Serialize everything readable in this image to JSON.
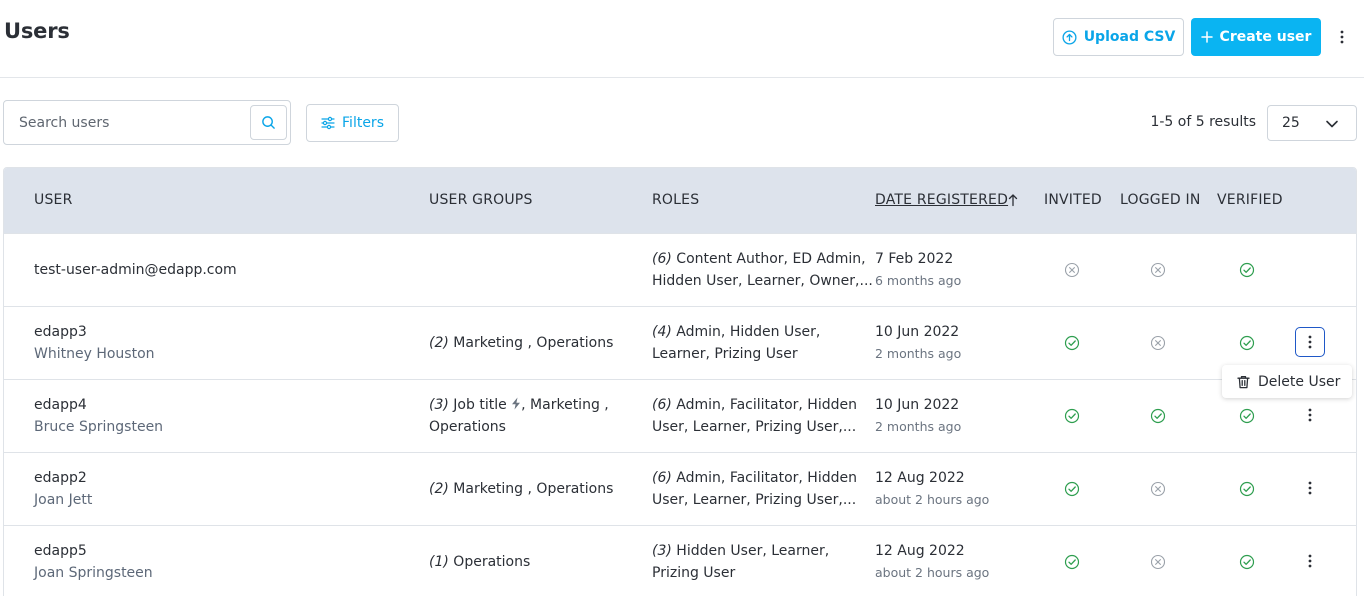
{
  "header": {
    "title": "Users",
    "upload_label": "Upload CSV",
    "create_label": "Create user"
  },
  "toolbar": {
    "search_placeholder": "Search users",
    "filters_label": "Filters",
    "results_text": "1-5 of 5 results",
    "page_size": "25"
  },
  "table": {
    "columns": {
      "user": "USER",
      "user_groups": "USER GROUPS",
      "roles": "ROLES",
      "date_registered": "DATE REGISTERED",
      "invited": "INVITED",
      "logged_in": "LOGGED IN",
      "verified": "VERIFIED"
    },
    "rows": [
      {
        "username": "test-user-admin@edapp.com",
        "name": "",
        "groups_count": "",
        "groups_line1": "",
        "groups_line2": "",
        "roles_count": "(6)",
        "roles_line1": "Content Author, ED Admin,",
        "roles_line2": "Hidden User, Learner, Owner,...",
        "date": "7 Feb 2022",
        "ago": "6 months ago",
        "invited": false,
        "logged_in": false,
        "verified": true
      },
      {
        "username": "edapp3",
        "name": "Whitney Houston",
        "groups_count": "(2)",
        "groups_line1": "Marketing , Operations",
        "groups_line2": "",
        "roles_count": "(4)",
        "roles_line1": "Admin, Hidden User,",
        "roles_line2": "Learner, Prizing User",
        "date": "10 Jun 2022",
        "ago": "2 months ago",
        "invited": true,
        "logged_in": false,
        "verified": true
      },
      {
        "username": "edapp4",
        "name": "Bruce Springsteen",
        "groups_count": "(3)",
        "groups_line1": "Job title",
        "groups_line1b": ", Marketing ,",
        "groups_line2": "Operations",
        "roles_count": "(6)",
        "roles_line1": "Admin, Facilitator, Hidden",
        "roles_line2": "User, Learner, Prizing User,...",
        "date": "10 Jun 2022",
        "ago": "2 months ago",
        "invited": true,
        "logged_in": true,
        "verified": true
      },
      {
        "username": "edapp2",
        "name": "Joan Jett",
        "groups_count": "(2)",
        "groups_line1": "Marketing , Operations",
        "groups_line2": "",
        "roles_count": "(6)",
        "roles_line1": "Admin, Facilitator, Hidden",
        "roles_line2": "User, Learner, Prizing User,...",
        "date": "12 Aug 2022",
        "ago": "about 2 hours ago",
        "invited": true,
        "logged_in": false,
        "verified": true
      },
      {
        "username": "edapp5",
        "name": "Joan Springsteen",
        "groups_count": "(1)",
        "groups_line1": "Operations",
        "groups_line2": "",
        "roles_count": "(3)",
        "roles_line1": "Hidden User, Learner,",
        "roles_line2": "Prizing User",
        "date": "12 Aug 2022",
        "ago": "about 2 hours ago",
        "invited": true,
        "logged_in": false,
        "verified": true
      }
    ]
  },
  "row_menu": {
    "delete_label": "Delete User"
  },
  "colors": {
    "accent": "#0ab4f2",
    "accent_text": "#0aa5e8",
    "header_bg": "#dde3ec",
    "check_green": "#2e9e4f",
    "cross_gray": "#9aa1a9",
    "focus_blue": "#1f58c7"
  },
  "icons": {
    "upload": "upload-circle-icon",
    "plus": "plus-icon",
    "more": "more-vertical-icon",
    "search": "search-icon",
    "filters": "sliders-icon",
    "chevron": "chevron-down-icon",
    "sort": "arrow-up-icon",
    "check": "check-circle-icon",
    "cross": "x-circle-icon",
    "bolt": "lightning-icon",
    "trash": "trash-icon"
  }
}
